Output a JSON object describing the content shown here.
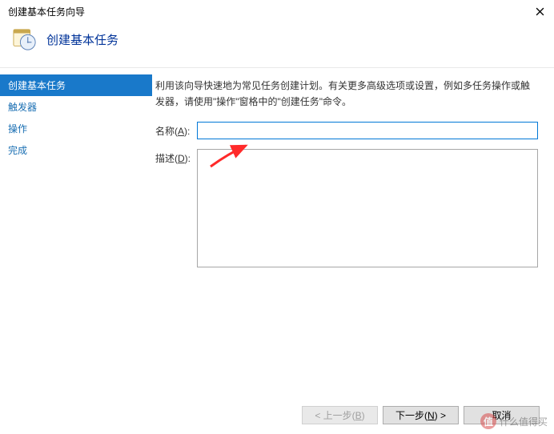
{
  "window": {
    "title": "创建基本任务向导"
  },
  "header": {
    "title": "创建基本任务"
  },
  "sidebar": {
    "items": [
      {
        "label": "创建基本任务",
        "selected": true
      },
      {
        "label": "触发器",
        "selected": false
      },
      {
        "label": "操作",
        "selected": false
      },
      {
        "label": "完成",
        "selected": false
      }
    ]
  },
  "main": {
    "intro": "利用该向导快速地为常见任务创建计划。有关更多高级选项或设置，例如多任务操作或触发器，请使用\"操作\"窗格中的\"创建任务\"命令。",
    "name_label_prefix": "名称(",
    "name_label_hotkey": "A",
    "name_label_suffix": "):",
    "name_value": "",
    "desc_label_prefix": "描述(",
    "desc_label_hotkey": "D",
    "desc_label_suffix": "):",
    "desc_value": ""
  },
  "footer": {
    "back_prefix": "< 上一步(",
    "back_hotkey": "B",
    "back_suffix": ")",
    "next_prefix": "下一步(",
    "next_hotkey": "N",
    "next_suffix": ") >",
    "cancel": "取消"
  },
  "watermark": {
    "badge": "值",
    "text": "什么值得买"
  }
}
